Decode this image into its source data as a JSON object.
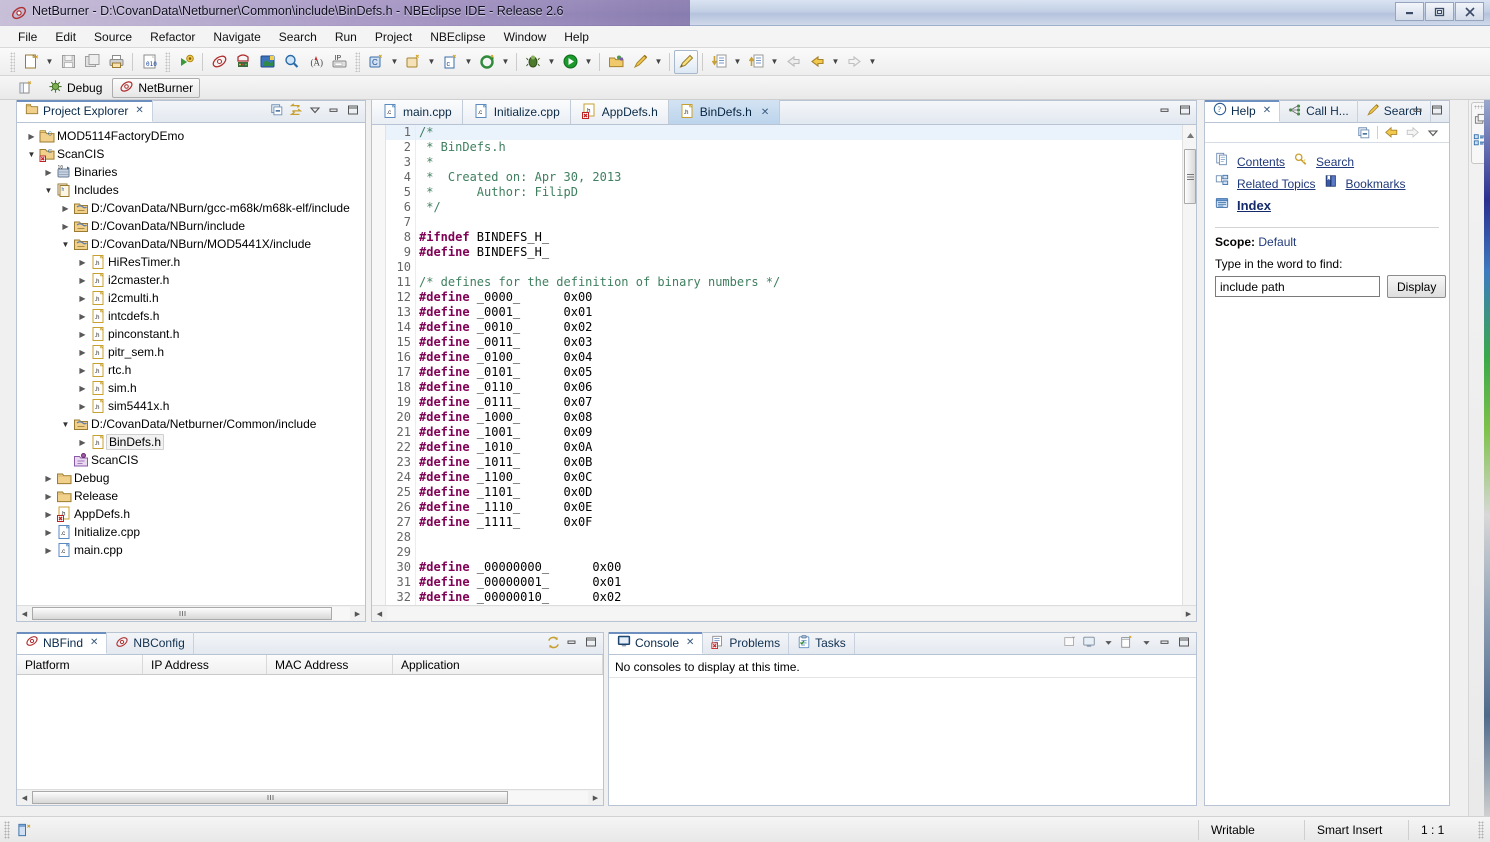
{
  "window": {
    "title": "NetBurner - D:\\CovanData\\Netburner\\Common\\include\\BinDefs.h - NBEclipse IDE - Release 2.6",
    "minimize": "—",
    "maximize": "❐",
    "close": "✕"
  },
  "menu": [
    "File",
    "Edit",
    "Source",
    "Refactor",
    "Navigate",
    "Search",
    "Run",
    "Project",
    "NBEclipse",
    "Window",
    "Help"
  ],
  "perspective": {
    "open_tooltip": "Open Perspective",
    "items": [
      {
        "label": "Debug",
        "icon": "debug-icon",
        "selected": false
      },
      {
        "label": "NetBurner",
        "icon": "netburner-icon",
        "selected": true
      }
    ]
  },
  "project_explorer": {
    "tab_label": "Project Explorer",
    "close_glyph": "✕",
    "tools": [
      "collapse-all-icon",
      "link-with-editor-icon",
      "view-menu-icon",
      "minimize-icon",
      "maximize-icon"
    ],
    "tree": [
      {
        "label": "MOD5114FactoryDEmo",
        "indent": 0,
        "twist": "closed",
        "icon": "cpp-project-icon"
      },
      {
        "label": "ScanCIS",
        "indent": 0,
        "twist": "open",
        "icon": "cpp-project-error-icon"
      },
      {
        "label": "Binaries",
        "indent": 1,
        "twist": "closed",
        "icon": "binaries-icon"
      },
      {
        "label": "Includes",
        "indent": 1,
        "twist": "open",
        "icon": "includes-icon"
      },
      {
        "label": "D:/CovanData/NBurn/gcc-m68k/m68k-elf/include",
        "indent": 2,
        "twist": "closed",
        "icon": "include-folder-icon"
      },
      {
        "label": "D:/CovanData/NBurn/include",
        "indent": 2,
        "twist": "closed",
        "icon": "include-folder-icon"
      },
      {
        "label": "D:/CovanData/NBurn/MOD5441X/include",
        "indent": 2,
        "twist": "open",
        "icon": "include-folder-icon"
      },
      {
        "label": "HiResTimer.h",
        "indent": 3,
        "twist": "closed",
        "icon": "header-file-icon"
      },
      {
        "label": "i2cmaster.h",
        "indent": 3,
        "twist": "closed",
        "icon": "header-file-icon"
      },
      {
        "label": "i2cmulti.h",
        "indent": 3,
        "twist": "closed",
        "icon": "header-file-icon"
      },
      {
        "label": "intcdefs.h",
        "indent": 3,
        "twist": "closed",
        "icon": "header-file-icon"
      },
      {
        "label": "pinconstant.h",
        "indent": 3,
        "twist": "closed",
        "icon": "header-file-icon"
      },
      {
        "label": "pitr_sem.h",
        "indent": 3,
        "twist": "closed",
        "icon": "header-file-icon"
      },
      {
        "label": "rtc.h",
        "indent": 3,
        "twist": "closed",
        "icon": "header-file-icon"
      },
      {
        "label": "sim.h",
        "indent": 3,
        "twist": "closed",
        "icon": "header-file-icon"
      },
      {
        "label": "sim5441x.h",
        "indent": 3,
        "twist": "closed",
        "icon": "header-file-icon"
      },
      {
        "label": "D:/CovanData/Netburner/Common/include",
        "indent": 2,
        "twist": "open",
        "icon": "include-folder-icon"
      },
      {
        "label": "BinDefs.h",
        "indent": 3,
        "twist": "closed",
        "icon": "header-file-icon",
        "selected": true
      },
      {
        "label": "ScanCIS",
        "indent": 2,
        "twist": "none",
        "icon": "source-folder-icon"
      },
      {
        "label": "Debug",
        "indent": 1,
        "twist": "closed",
        "icon": "folder-icon"
      },
      {
        "label": "Release",
        "indent": 1,
        "twist": "closed",
        "icon": "folder-icon"
      },
      {
        "label": "AppDefs.h",
        "indent": 1,
        "twist": "closed",
        "icon": "header-file-error-icon"
      },
      {
        "label": "Initialize.cpp",
        "indent": 1,
        "twist": "closed",
        "icon": "cpp-file-icon"
      },
      {
        "label": "main.cpp",
        "indent": 1,
        "twist": "closed",
        "icon": "cpp-file-icon"
      }
    ]
  },
  "editor": {
    "tabs": [
      {
        "label": "main.cpp",
        "icon": "cpp-file-icon",
        "selected": false
      },
      {
        "label": "Initialize.cpp",
        "icon": "cpp-file-icon",
        "selected": false
      },
      {
        "label": "AppDefs.h",
        "icon": "header-file-error-icon",
        "selected": false
      },
      {
        "label": "BinDefs.h",
        "icon": "header-file-icon",
        "selected": true,
        "close_glyph": "✕"
      }
    ],
    "minimize": "—",
    "maximize": "❐",
    "lines": [
      {
        "n": 1,
        "segments": [
          {
            "t": "/*",
            "c": "cm"
          }
        ],
        "current": true
      },
      {
        "n": 2,
        "segments": [
          {
            "t": " * BinDefs.h",
            "c": "cm"
          }
        ]
      },
      {
        "n": 3,
        "segments": [
          {
            "t": " *",
            "c": "cm"
          }
        ]
      },
      {
        "n": 4,
        "segments": [
          {
            "t": " *  Created on: Apr 30, 2013",
            "c": "cm"
          }
        ]
      },
      {
        "n": 5,
        "segments": [
          {
            "t": " *      Author: FilipD",
            "c": "cm"
          }
        ]
      },
      {
        "n": 6,
        "segments": [
          {
            "t": " */",
            "c": "cm"
          }
        ]
      },
      {
        "n": 7,
        "segments": []
      },
      {
        "n": 8,
        "segments": [
          {
            "t": "#ifndef",
            "c": "kw"
          },
          {
            "t": " BINDEFS_H_",
            "c": ""
          }
        ]
      },
      {
        "n": 9,
        "segments": [
          {
            "t": "#define",
            "c": "kw"
          },
          {
            "t": " BINDEFS_H_",
            "c": ""
          }
        ]
      },
      {
        "n": 10,
        "segments": []
      },
      {
        "n": 11,
        "segments": [
          {
            "t": "/* defines for the definition of binary numbers */",
            "c": "cm"
          }
        ]
      },
      {
        "n": 12,
        "segments": [
          {
            "t": "#define",
            "c": "kw"
          },
          {
            "t": " _0000_      0x00",
            "c": ""
          }
        ]
      },
      {
        "n": 13,
        "segments": [
          {
            "t": "#define",
            "c": "kw"
          },
          {
            "t": " _0001_      0x01",
            "c": ""
          }
        ]
      },
      {
        "n": 14,
        "segments": [
          {
            "t": "#define",
            "c": "kw"
          },
          {
            "t": " _0010_      0x02",
            "c": ""
          }
        ]
      },
      {
        "n": 15,
        "segments": [
          {
            "t": "#define",
            "c": "kw"
          },
          {
            "t": " _0011_      0x03",
            "c": ""
          }
        ]
      },
      {
        "n": 16,
        "segments": [
          {
            "t": "#define",
            "c": "kw"
          },
          {
            "t": " _0100_      0x04",
            "c": ""
          }
        ]
      },
      {
        "n": 17,
        "segments": [
          {
            "t": "#define",
            "c": "kw"
          },
          {
            "t": " _0101_      0x05",
            "c": ""
          }
        ]
      },
      {
        "n": 18,
        "segments": [
          {
            "t": "#define",
            "c": "kw"
          },
          {
            "t": " _0110_      0x06",
            "c": ""
          }
        ]
      },
      {
        "n": 19,
        "segments": [
          {
            "t": "#define",
            "c": "kw"
          },
          {
            "t": " _0111_      0x07",
            "c": ""
          }
        ]
      },
      {
        "n": 20,
        "segments": [
          {
            "t": "#define",
            "c": "kw"
          },
          {
            "t": " _1000_      0x08",
            "c": ""
          }
        ]
      },
      {
        "n": 21,
        "segments": [
          {
            "t": "#define",
            "c": "kw"
          },
          {
            "t": " _1001_      0x09",
            "c": ""
          }
        ]
      },
      {
        "n": 22,
        "segments": [
          {
            "t": "#define",
            "c": "kw"
          },
          {
            "t": " _1010_      0x0A",
            "c": ""
          }
        ]
      },
      {
        "n": 23,
        "segments": [
          {
            "t": "#define",
            "c": "kw"
          },
          {
            "t": " _1011_      0x0B",
            "c": ""
          }
        ]
      },
      {
        "n": 24,
        "segments": [
          {
            "t": "#define",
            "c": "kw"
          },
          {
            "t": " _1100_      0x0C",
            "c": ""
          }
        ]
      },
      {
        "n": 25,
        "segments": [
          {
            "t": "#define",
            "c": "kw"
          },
          {
            "t": " _1101_      0x0D",
            "c": ""
          }
        ]
      },
      {
        "n": 26,
        "segments": [
          {
            "t": "#define",
            "c": "kw"
          },
          {
            "t": " _1110_      0x0E",
            "c": ""
          }
        ]
      },
      {
        "n": 27,
        "segments": [
          {
            "t": "#define",
            "c": "kw"
          },
          {
            "t": " _1111_      0x0F",
            "c": ""
          }
        ]
      },
      {
        "n": 28,
        "segments": []
      },
      {
        "n": 29,
        "segments": []
      },
      {
        "n": 30,
        "segments": [
          {
            "t": "#define",
            "c": "kw"
          },
          {
            "t": " _00000000_      0x00",
            "c": ""
          }
        ]
      },
      {
        "n": 31,
        "segments": [
          {
            "t": "#define",
            "c": "kw"
          },
          {
            "t": " _00000001_      0x01",
            "c": ""
          }
        ]
      },
      {
        "n": 32,
        "segments": [
          {
            "t": "#define",
            "c": "kw"
          },
          {
            "t": " _00000010_      0x02",
            "c": ""
          }
        ]
      }
    ]
  },
  "help": {
    "tabs": [
      {
        "label": "Help",
        "icon": "help-icon",
        "selected": true,
        "close_glyph": "✕"
      },
      {
        "label": "Call H...",
        "icon": "call-hierarchy-icon",
        "selected": false
      },
      {
        "label": "Search",
        "icon": "search-icon",
        "selected": false
      }
    ],
    "minimize": "—",
    "maximize": "❐",
    "toolrow": [
      "collapse-all-icon",
      "back-arrow-icon",
      "forward-arrow-icon",
      "view-menu-icon"
    ],
    "links": [
      {
        "label": "Contents",
        "icon": "contents-icon",
        "bold": false
      },
      {
        "label": "Search",
        "icon": "search-help-icon",
        "bold": false
      },
      {
        "label": "Related Topics",
        "icon": "related-topics-icon",
        "bold": false
      },
      {
        "label": "Bookmarks",
        "icon": "bookmarks-icon",
        "bold": false
      },
      {
        "label": "Index",
        "icon": "index-icon",
        "bold": true
      }
    ],
    "scope_label": "Scope:",
    "scope_value": "Default",
    "find_prompt": "Type in the word to find:",
    "find_value": "include path",
    "find_placeholder": "",
    "display_button": "Display"
  },
  "nbfind": {
    "tabs": [
      {
        "label": "NBFind",
        "icon": "netburner-icon",
        "selected": true,
        "close_glyph": "✕"
      },
      {
        "label": "NBConfig",
        "icon": "netburner-icon",
        "selected": false
      }
    ],
    "tools": [
      "refresh-icon",
      "minimize-icon",
      "maximize-icon"
    ],
    "columns": [
      "Platform",
      "IP Address",
      "MAC Address",
      "Application"
    ],
    "rows": []
  },
  "console": {
    "tabs": [
      {
        "label": "Console",
        "icon": "console-icon",
        "selected": true,
        "close_glyph": "✕"
      },
      {
        "label": "Problems",
        "icon": "problems-icon",
        "selected": false
      },
      {
        "label": "Tasks",
        "icon": "tasks-icon",
        "selected": false
      }
    ],
    "tools": [
      "open-console-icon",
      "display-console-icon",
      "dropdown-icon",
      "new-console-icon",
      "dropdown-icon-2",
      "minimize-icon",
      "maximize-icon"
    ],
    "message": "No consoles to display at this time."
  },
  "statusbar": {
    "left_icon": "editor-status-icon",
    "cells": [
      "Writable",
      "Smart Insert",
      "1 : 1"
    ]
  },
  "fastview": {
    "items": [
      "restore-icon",
      "outline-icon"
    ]
  },
  "colors": {
    "accent": "#20397a",
    "keyword": "#7f0055",
    "comment": "#3f7f5f",
    "tab_selected_bg": "#bcd4ec",
    "current_line": "#eaf2fb"
  }
}
